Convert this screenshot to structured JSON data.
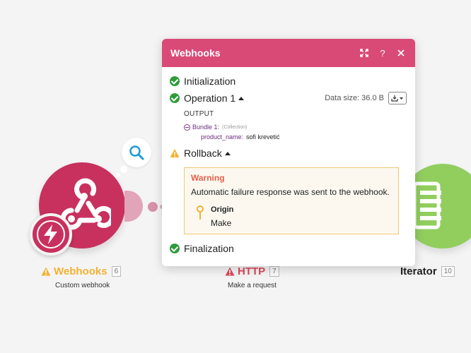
{
  "popup": {
    "title": "Webhooks",
    "steps": {
      "initialization": "Initialization",
      "operation": "Operation 1",
      "data_size": "Data size: 36.0 B",
      "output_label": "OUTPUT",
      "bundle_name": "Bundle 1:",
      "bundle_type": "(Collection)",
      "prop_key": "product_name:",
      "prop_val": "sofi krevetić",
      "rollback": "Rollback",
      "finalization": "Finalization"
    },
    "warning": {
      "title": "Warning",
      "text": "Automatic failure response was sent to the webhook.",
      "origin_title": "Origin",
      "origin_value": "Make"
    }
  },
  "modules": [
    {
      "name": "Webhooks",
      "count": "6",
      "subtitle": "Custom webhook",
      "color": "#c8315e",
      "label_color": "#f2b233"
    },
    {
      "name": "HTTP",
      "count": "7",
      "subtitle": "Make a request",
      "color": "#d8556f",
      "label_color": "#d84a5e"
    },
    {
      "name": "Iterator",
      "count": "10",
      "subtitle": "",
      "color": "#91ce5e",
      "label_color": "#222222"
    }
  ],
  "colors": {
    "header": "#da4a76",
    "success": "#2e9b3a",
    "warning_border": "#f0c674",
    "warning_title": "#e4604a"
  }
}
